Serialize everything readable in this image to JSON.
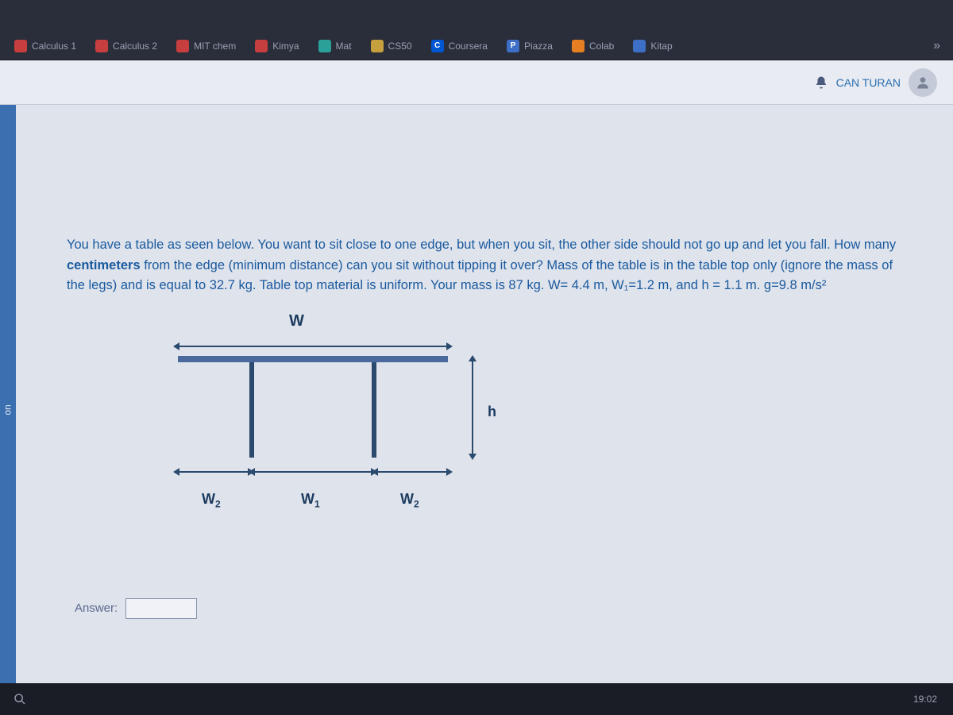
{
  "bookmarks": {
    "b0": "Calculus 1",
    "b1": "Calculus 2",
    "b2": "MIT chem",
    "b3": "Kimya",
    "b4": "Mat",
    "b5": "CS50",
    "b6": "Coursera",
    "b7": "Piazza",
    "b8": "Colab",
    "b9": "Kitap",
    "overflow": "»"
  },
  "header": {
    "user_name": "CAN TURAN"
  },
  "sidebar": {
    "label": "on"
  },
  "question": {
    "text_html": "You have a table as seen below. You want to sit close to one edge, but when you sit, the other side should not go up and let you fall. How many <b>centimeters</b> from the edge (minimum distance) can you sit without tipping it over? Mass of the table is in the table top only (ignore the mass of the legs) and is equal to 32.7 kg. Table top material is uniform. Your mass is 87 kg. W= 4.4 m, W₁=1.2 m, and h = 1.1 m. g=9.8 m/s²",
    "values": {
      "table_mass_kg": 32.7,
      "person_mass_kg": 87,
      "W_m": 4.4,
      "W1_m": 1.2,
      "h_m": 1.1,
      "g": 9.8
    }
  },
  "diagram": {
    "top_label": "W",
    "height_label": "h",
    "w2_left": "W₂",
    "w1": "W₁",
    "w2_right": "W₂"
  },
  "answer": {
    "label": "Answer:",
    "value": ""
  },
  "taskbar": {
    "time": "19:02"
  }
}
